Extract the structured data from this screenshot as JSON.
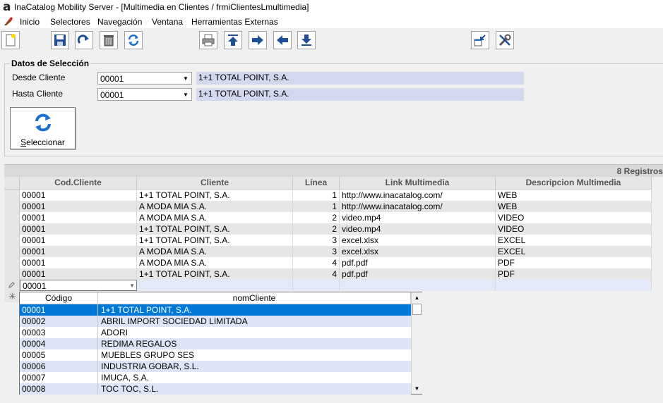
{
  "window": {
    "app_icon": "a",
    "title": "InaCatalog Mobility Server - [Multimedia en Clientes / frmiClientesLmultimedia]"
  },
  "menu": {
    "icon": "paint-brush-icon",
    "items": [
      "Inicio",
      "Selectores",
      "Navegación",
      "Ventana",
      "Herramientas Externas"
    ]
  },
  "toolbar": {
    "icons": [
      "new-document-icon",
      "save-icon",
      "redo-icon",
      "trash-icon",
      "refresh-icon",
      "print-icon",
      "first-record-icon",
      "next-record-icon",
      "previous-record-icon",
      "last-record-icon",
      "window-arrange-icon",
      "tools-icon"
    ]
  },
  "selection": {
    "legend": "Datos de Selección",
    "desde_label": "Desde Cliente",
    "desde_code": "00001",
    "desde_name": "1+1 TOTAL POINT, S.A.",
    "hasta_label": "Hasta Cliente",
    "hasta_code": "00001",
    "hasta_name": "1+1 TOTAL POINT, S.A.",
    "button_accel": "S",
    "button_rest": "eleccionar"
  },
  "grid": {
    "record_count": "8 Registros",
    "headers": [
      "Cod.Cliente",
      "Cliente",
      "Línea",
      "Link Multimedia",
      "Descripcion Multimedia"
    ],
    "rows": [
      [
        "00001",
        "1+1 TOTAL POINT, S.A.",
        "1",
        "http://www.inacatalog.com/",
        "WEB"
      ],
      [
        "00001",
        "A MODA MIA S.A.",
        "1",
        "http://www.inacatalog.com/",
        "WEB"
      ],
      [
        "00001",
        "A MODA MIA S.A.",
        "2",
        "video.mp4",
        "VIDEO"
      ],
      [
        "00001",
        "1+1 TOTAL POINT, S.A.",
        "2",
        "video.mp4",
        "VIDEO"
      ],
      [
        "00001",
        "1+1 TOTAL POINT, S.A.",
        "3",
        "excel.xlsx",
        "EXCEL"
      ],
      [
        "00001",
        "A MODA MIA S.A.",
        "3",
        "excel.xlsx",
        "EXCEL"
      ],
      [
        "00001",
        "A MODA MIA S.A.",
        "4",
        "pdf.pdf",
        "PDF"
      ],
      [
        "00001",
        "1+1 TOTAL POINT, S.A.",
        "4",
        "pdf.pdf",
        "PDF"
      ]
    ],
    "edit_row_value": "00001",
    "edit_marker": "pencil-icon",
    "new_marker": "asterisk-icon"
  },
  "dropdown": {
    "headers": [
      "Código",
      "nomCliente"
    ],
    "rows": [
      [
        "00001",
        "1+1 TOTAL POINT, S.A."
      ],
      [
        "00002",
        "ABRIL IMPORT SOCIEDAD LIMITADA"
      ],
      [
        "00003",
        "ADORI"
      ],
      [
        "00004",
        "REDIMA REGALOS"
      ],
      [
        "00005",
        "MUEBLES GRUPO SES"
      ],
      [
        "00006",
        "INDUSTRIA GOBAR, S.L."
      ],
      [
        "00007",
        "IMUCA, S.A."
      ],
      [
        "00008",
        "TOC TOC, S.L."
      ]
    ],
    "selected_index": 0
  },
  "colors": {
    "selection_blue": "#0078d7",
    "alt_row": "#e6e6e6",
    "name_box": "#d3d8ef",
    "edit_row": "#e3e9f8",
    "dd_alt_row": "#dde4f6"
  }
}
